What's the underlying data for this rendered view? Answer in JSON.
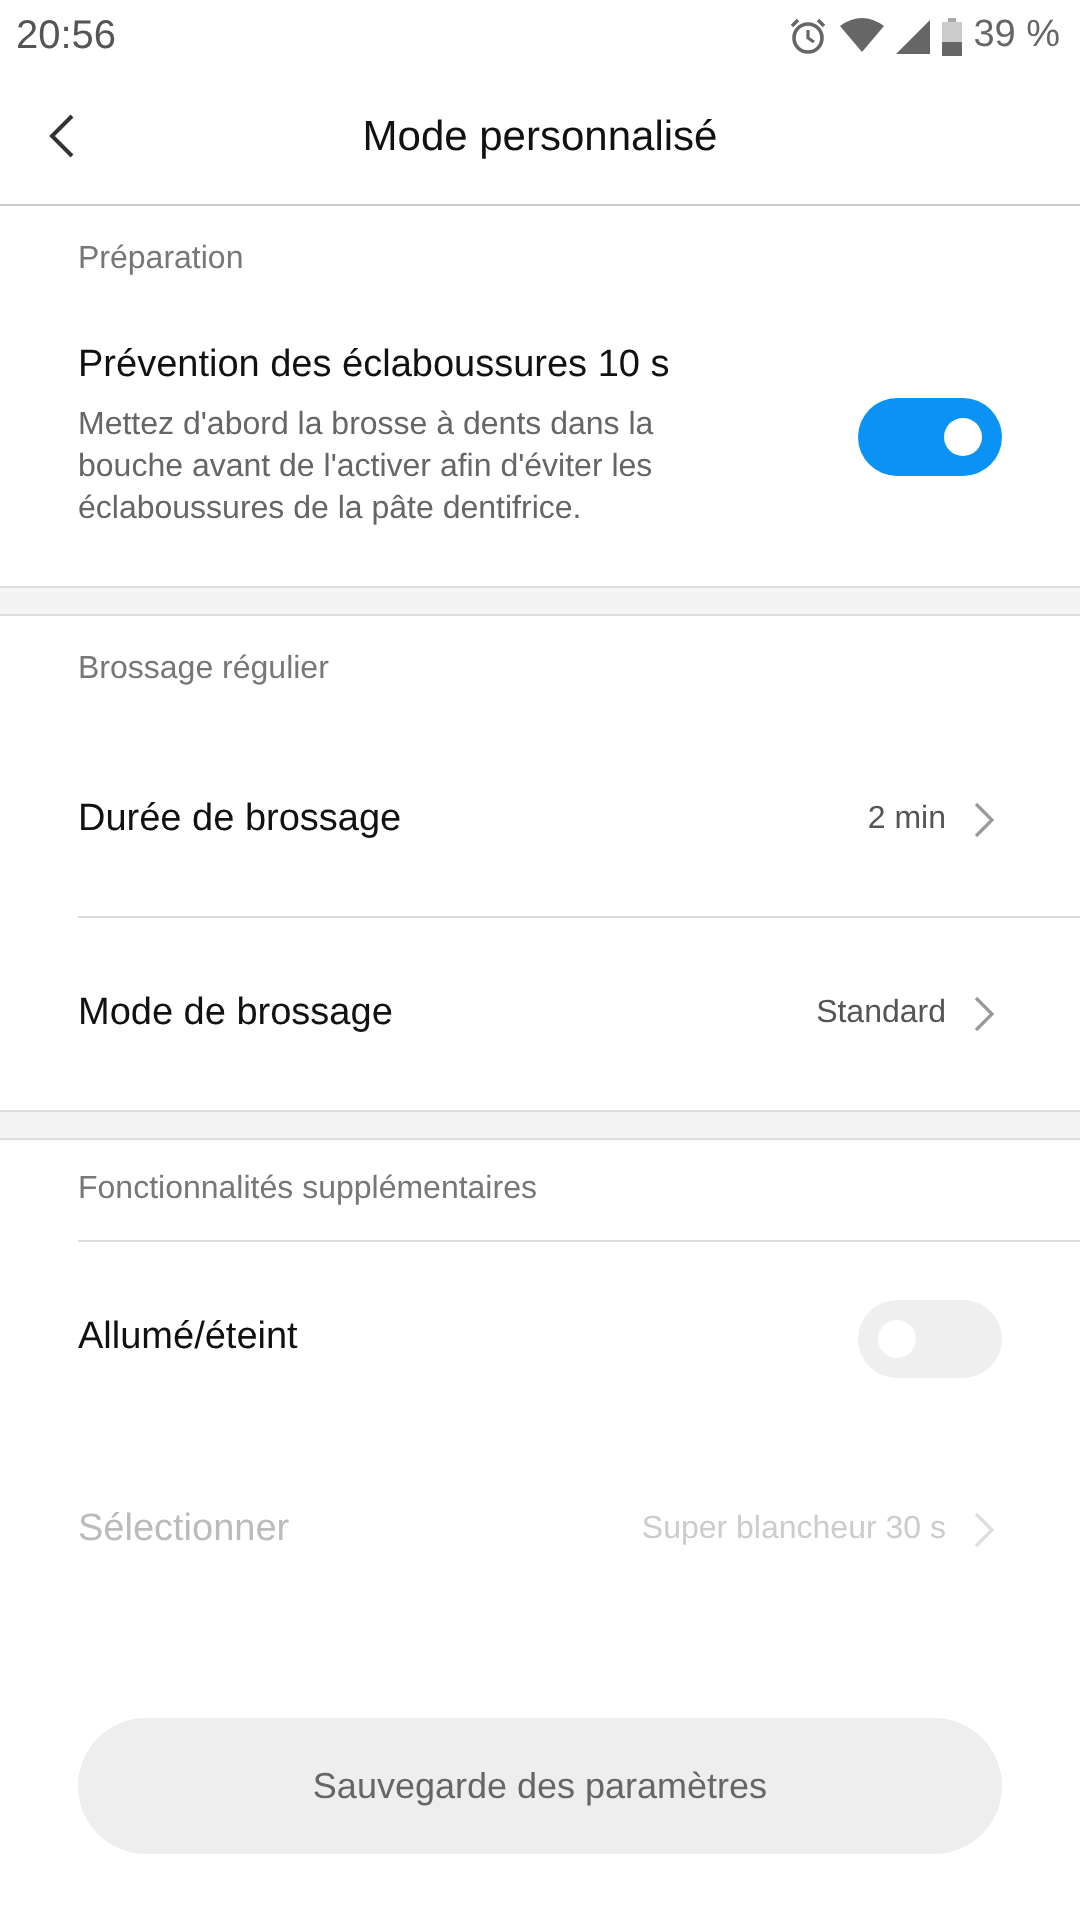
{
  "status_bar": {
    "time": "20:56",
    "battery": "39 %"
  },
  "header": {
    "title": "Mode personnalisé"
  },
  "sections": [
    {
      "title": "Préparation",
      "items": [
        {
          "kind": "toggle",
          "label": "Prévention des éclaboussures 10 s",
          "description": "Mettez d'abord la brosse à dents dans la bouche avant de l'activer afin d'éviter les éclaboussures de la pâte dentifrice.",
          "on": true
        }
      ]
    },
    {
      "title": "Brossage régulier",
      "items": [
        {
          "kind": "nav",
          "label": "Durée de brossage",
          "value": "2 min",
          "disabled": false
        },
        {
          "kind": "nav",
          "label": "Mode de brossage",
          "value": "Standard",
          "disabled": false
        }
      ]
    },
    {
      "title": "Fonctionnalités supplémentaires",
      "items": [
        {
          "kind": "toggle",
          "label": "Allumé/éteint",
          "on": false
        },
        {
          "kind": "nav",
          "label": "Sélectionner",
          "value": "Super blancheur 30 s",
          "disabled": true
        }
      ]
    }
  ],
  "save_button": {
    "label": "Sauvegarde des paramètres"
  }
}
